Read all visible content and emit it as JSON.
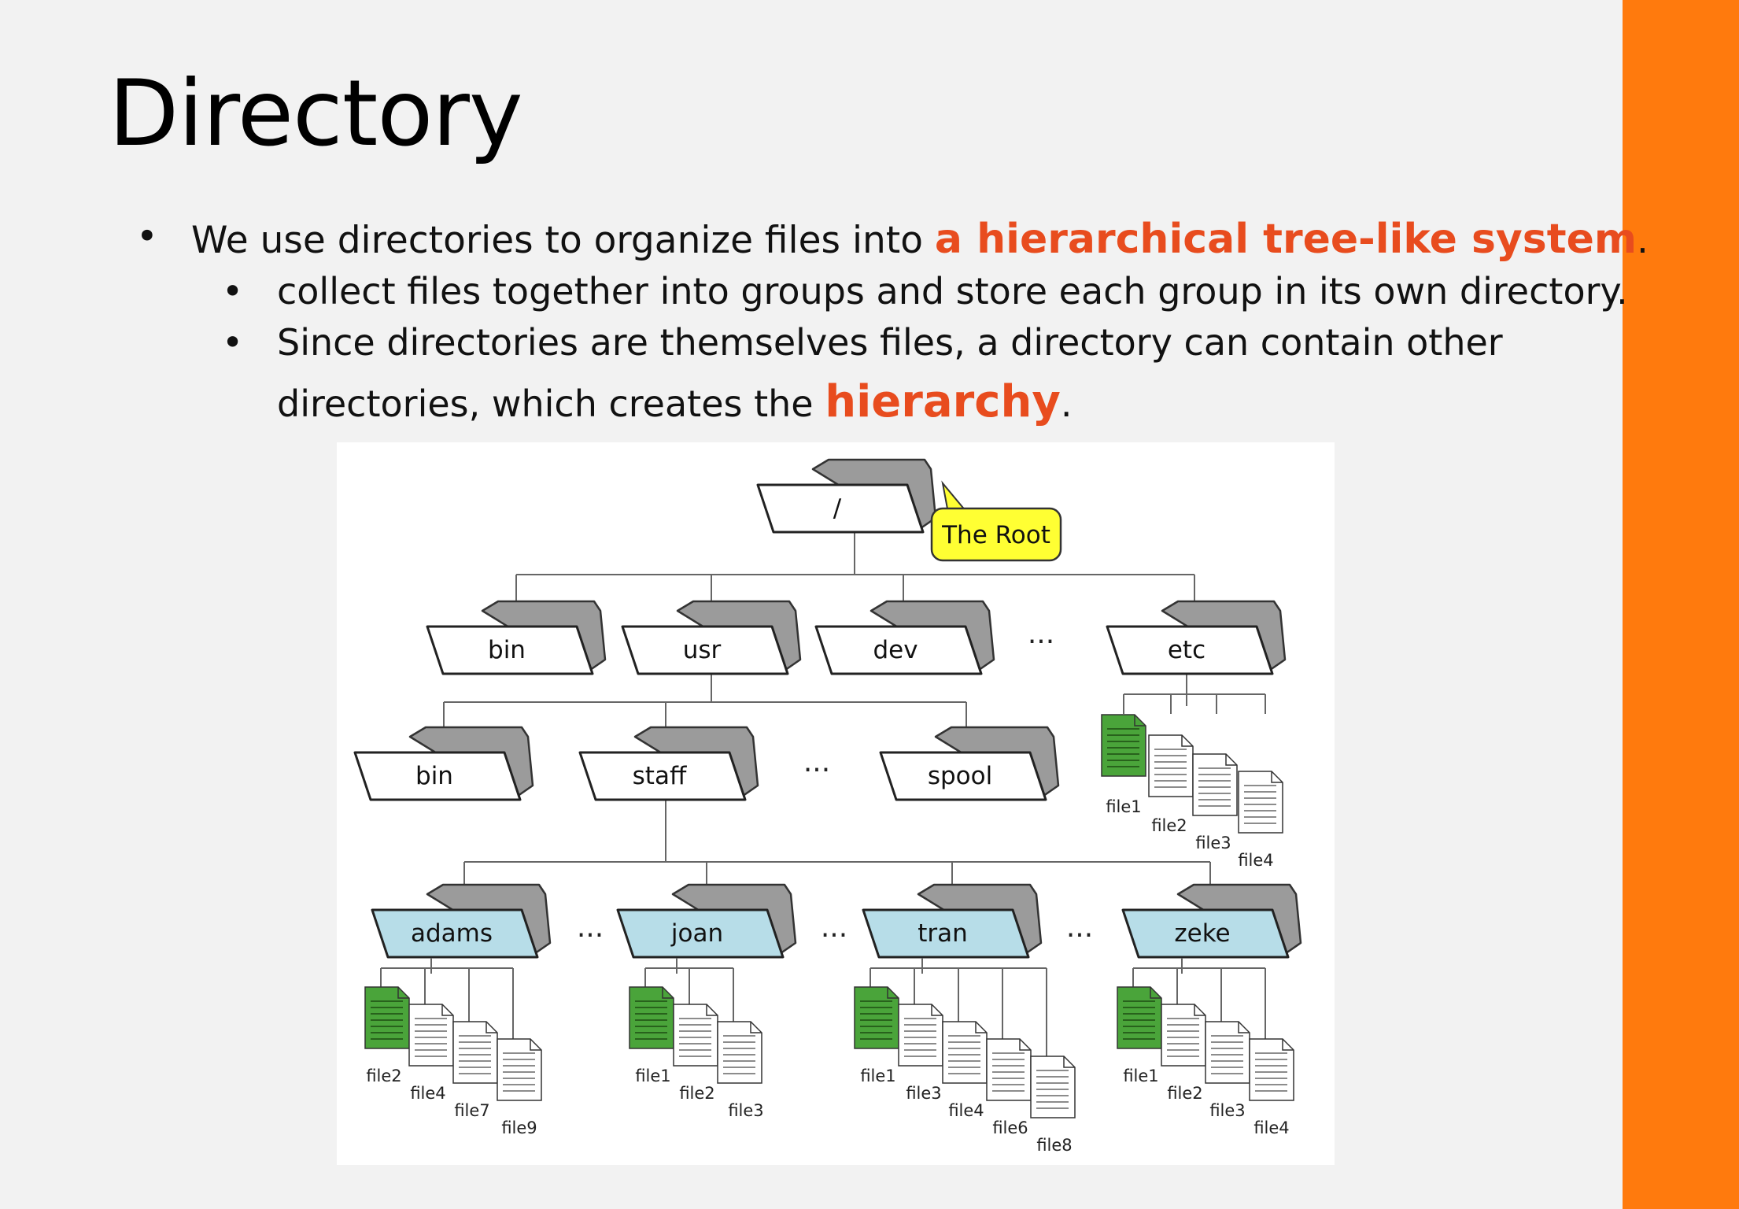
{
  "title": "Directory",
  "colors": {
    "accent": "#ff7a0d",
    "highlight": "#e84c1e",
    "callout": "#ffff33",
    "user_folder": "#b7dde8",
    "file_green": "#4aa43a"
  },
  "bullets": [
    {
      "pre": "We use directories to organize files into ",
      "highlight": "a hierarchical tree-like system",
      "post": "."
    },
    {
      "text": "collect files together into groups and store each group in its own directory."
    },
    {
      "line1": "Since directories are themselves files, a directory can contain other",
      "pre": "directories, which creates the ",
      "highlight": "hierarchy",
      "post": "."
    }
  ],
  "diagram": {
    "root": {
      "label": "/",
      "callout": "The Root"
    },
    "level1": [
      {
        "label": "bin"
      },
      {
        "label": "usr"
      },
      {
        "label": "dev"
      },
      {
        "label": "etc"
      }
    ],
    "level2": [
      {
        "label": "bin"
      },
      {
        "label": "staff"
      },
      {
        "label": "spool"
      }
    ],
    "users": [
      {
        "label": "adams",
        "files": [
          "file2",
          "file4",
          "file7",
          "file9"
        ]
      },
      {
        "label": "joan",
        "files": [
          "file1",
          "file2",
          "file3"
        ]
      },
      {
        "label": "tran",
        "files": [
          "file1",
          "file3",
          "file4",
          "file6",
          "file8"
        ]
      },
      {
        "label": "zeke",
        "files": [
          "file1",
          "file2",
          "file3",
          "file4"
        ]
      }
    ],
    "etc_files": [
      "file1",
      "file2",
      "file3",
      "file4"
    ],
    "ellipsis": "..."
  }
}
